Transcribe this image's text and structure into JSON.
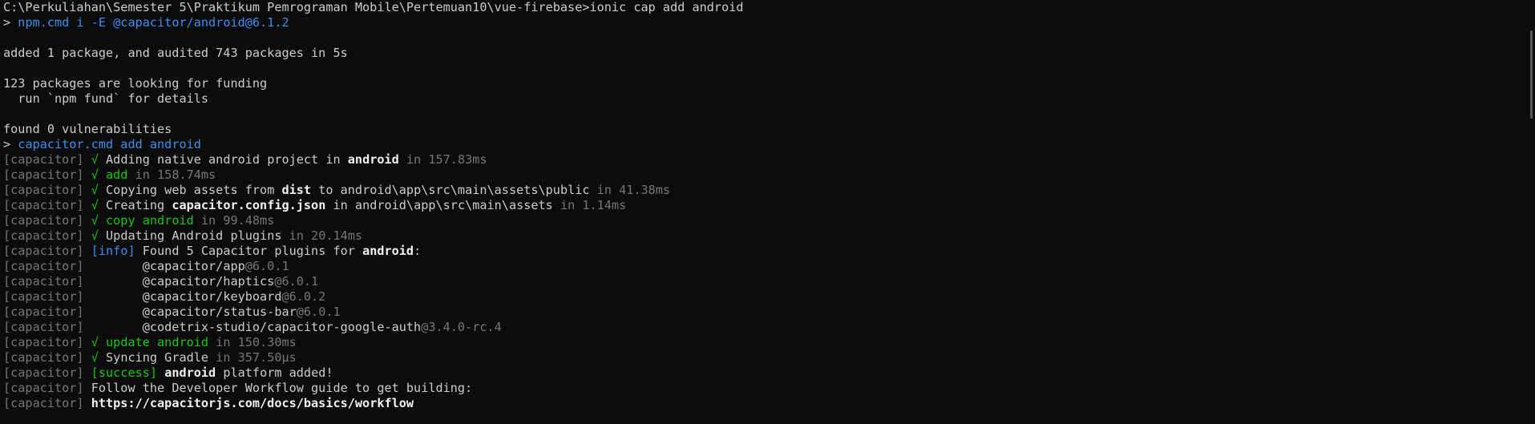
{
  "colors": {
    "background": "#0c0c0c",
    "normal": "#cccccc",
    "bright": "#f2f2f2",
    "blue": "#3b8eea",
    "green": "#16c60c",
    "gray": "#767676"
  },
  "terminal": {
    "lines": [
      [
        {
          "t": "C:\\Perkuliahan\\Semester 5\\Praktikum Pemrograman Mobile\\Pertemuan10\\vue-firebase>ionic cap add android",
          "c": "normal"
        }
      ],
      [
        {
          "t": "> ",
          "c": "normal"
        },
        {
          "t": "npm.cmd i -E @capacitor/android@6.1.2",
          "c": "blue"
        }
      ],
      [],
      [
        {
          "t": "added 1 package, and audited 743 packages in 5s",
          "c": "normal"
        }
      ],
      [],
      [
        {
          "t": "123 packages are looking for funding",
          "c": "normal"
        }
      ],
      [
        {
          "t": "  run `npm fund` for details",
          "c": "normal"
        }
      ],
      [],
      [
        {
          "t": "found ",
          "c": "normal"
        },
        {
          "t": "0",
          "c": "normal"
        },
        {
          "t": " vulnerabilities",
          "c": "normal"
        }
      ],
      [
        {
          "t": "> ",
          "c": "normal"
        },
        {
          "t": "capacitor.cmd add android",
          "c": "blue"
        }
      ],
      [
        {
          "t": "[capacitor] ",
          "c": "gray"
        },
        {
          "t": "√ ",
          "c": "green"
        },
        {
          "t": "Adding native android project in ",
          "c": "normal"
        },
        {
          "t": "android",
          "c": "bright"
        },
        {
          "t": " in 157.83ms",
          "c": "gray"
        }
      ],
      [
        {
          "t": "[capacitor] ",
          "c": "gray"
        },
        {
          "t": "√ add",
          "c": "green"
        },
        {
          "t": " in 158.74ms",
          "c": "gray"
        }
      ],
      [
        {
          "t": "[capacitor] ",
          "c": "gray"
        },
        {
          "t": "√ ",
          "c": "green"
        },
        {
          "t": "Copying web assets from ",
          "c": "normal"
        },
        {
          "t": "dist",
          "c": "bright"
        },
        {
          "t": " to android\\app\\src\\main\\assets\\public",
          "c": "normal"
        },
        {
          "t": " in 41.38ms",
          "c": "gray"
        }
      ],
      [
        {
          "t": "[capacitor] ",
          "c": "gray"
        },
        {
          "t": "√ ",
          "c": "green"
        },
        {
          "t": "Creating ",
          "c": "normal"
        },
        {
          "t": "capacitor.config.json",
          "c": "bright"
        },
        {
          "t": " in android\\app\\src\\main\\assets",
          "c": "normal"
        },
        {
          "t": " in 1.14ms",
          "c": "gray"
        }
      ],
      [
        {
          "t": "[capacitor] ",
          "c": "gray"
        },
        {
          "t": "√ copy android",
          "c": "green"
        },
        {
          "t": " in 99.48ms",
          "c": "gray"
        }
      ],
      [
        {
          "t": "[capacitor] ",
          "c": "gray"
        },
        {
          "t": "√ ",
          "c": "green"
        },
        {
          "t": "Updating Android plugins",
          "c": "normal"
        },
        {
          "t": " in 20.14ms",
          "c": "gray"
        }
      ],
      [
        {
          "t": "[capacitor] ",
          "c": "gray"
        },
        {
          "t": "[info]",
          "c": "blue"
        },
        {
          "t": " Found 5 Capacitor plugins for ",
          "c": "normal"
        },
        {
          "t": "android",
          "c": "bright"
        },
        {
          "t": ":",
          "c": "normal"
        }
      ],
      [
        {
          "t": "[capacitor]        ",
          "c": "gray"
        },
        {
          "t": "@capacitor/app",
          "c": "normal"
        },
        {
          "t": "@6.0.1",
          "c": "gray"
        }
      ],
      [
        {
          "t": "[capacitor]        ",
          "c": "gray"
        },
        {
          "t": "@capacitor/haptics",
          "c": "normal"
        },
        {
          "t": "@6.0.1",
          "c": "gray"
        }
      ],
      [
        {
          "t": "[capacitor]        ",
          "c": "gray"
        },
        {
          "t": "@capacitor/keyboard",
          "c": "normal"
        },
        {
          "t": "@6.0.2",
          "c": "gray"
        }
      ],
      [
        {
          "t": "[capacitor]        ",
          "c": "gray"
        },
        {
          "t": "@capacitor/status-bar",
          "c": "normal"
        },
        {
          "t": "@6.0.1",
          "c": "gray"
        }
      ],
      [
        {
          "t": "[capacitor]        ",
          "c": "gray"
        },
        {
          "t": "@codetrix-studio/capacitor-google-auth",
          "c": "normal"
        },
        {
          "t": "@3.4.0-rc.4",
          "c": "gray"
        }
      ],
      [
        {
          "t": "[capacitor] ",
          "c": "gray"
        },
        {
          "t": "√ update android",
          "c": "green"
        },
        {
          "t": " in 150.30ms",
          "c": "gray"
        }
      ],
      [
        {
          "t": "[capacitor] ",
          "c": "gray"
        },
        {
          "t": "√ ",
          "c": "green"
        },
        {
          "t": "Syncing Gradle",
          "c": "normal"
        },
        {
          "t": " in 357.50μs",
          "c": "gray"
        }
      ],
      [
        {
          "t": "[capacitor] ",
          "c": "gray"
        },
        {
          "t": "[success]",
          "c": "green"
        },
        {
          "t": " ",
          "c": "normal"
        },
        {
          "t": "android",
          "c": "bright"
        },
        {
          "t": " platform added!",
          "c": "normal"
        }
      ],
      [
        {
          "t": "[capacitor] ",
          "c": "gray"
        },
        {
          "t": "Follow the Developer Workflow guide to get building:",
          "c": "normal"
        }
      ],
      [
        {
          "t": "[capacitor] ",
          "c": "gray"
        },
        {
          "t": "https://capacitorjs.com/docs/basics/workflow",
          "c": "bright"
        }
      ]
    ]
  }
}
